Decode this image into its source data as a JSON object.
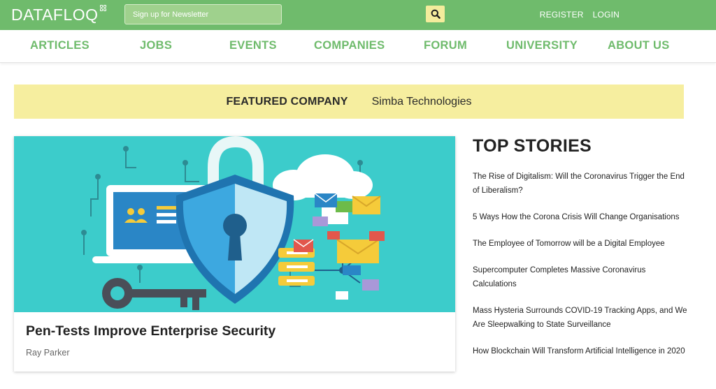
{
  "header": {
    "logo_text": "DATAFLOQ",
    "newsletter_placeholder": "Sign up for Newsletter",
    "register_label": "REGISTER",
    "login_label": "LOGIN",
    "search_icon": "search-icon"
  },
  "nav": {
    "items": [
      "ARTICLES",
      "JOBS",
      "EVENTS",
      "COMPANIES",
      "FORUM",
      "UNIVERSITY",
      "ABOUT US"
    ]
  },
  "featured": {
    "label": "FEATURED COMPANY",
    "company": "Simba Technologies"
  },
  "article": {
    "title": "Pen-Tests Improve Enterprise Security",
    "author": "Ray Parker",
    "image_icon": "security-shield-illustration"
  },
  "top_stories": {
    "heading": "TOP STORIES",
    "items": [
      "The Rise of Digitalism: Will the Coronavirus Trigger the End of Liberalism?",
      "5 Ways How the Corona Crisis Will Change Organisations",
      "The Employee of Tomorrow will be a Digital Employee",
      "Supercomputer Completes Massive Coronavirus Calculations",
      "Mass Hysteria Surrounds COVID-19 Tracking Apps, and We Are Sleepwalking to State Surveillance",
      "How Blockchain Will Transform Artificial Intelligence in 2020"
    ]
  },
  "colors": {
    "brand_green": "#6fbb6c",
    "banner_yellow": "#f6ee9f",
    "image_teal": "#3ccccb"
  }
}
